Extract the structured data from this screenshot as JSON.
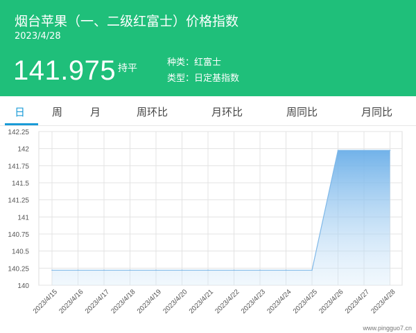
{
  "header": {
    "title": "烟台苹果（一、二级红富士）价格指数",
    "date": "2023/4/28",
    "price": "141.975",
    "change": "持平",
    "category_label": "种类：",
    "category_value": "红富士",
    "type_label": "类型：",
    "type_value": "日定基指数"
  },
  "colors": {
    "brand": "#1fbf7a",
    "active_tab": "#1a9bd7",
    "line": "#7fb8e8"
  },
  "tabs": [
    {
      "label": "日",
      "active": true
    },
    {
      "label": "周",
      "active": false
    },
    {
      "label": "月",
      "active": false
    },
    {
      "label": "周环比",
      "active": false
    },
    {
      "label": "月环比",
      "active": false
    },
    {
      "label": "周同比",
      "active": false
    },
    {
      "label": "月同比",
      "active": false
    }
  ],
  "watermark": "www.pingguo7.cn",
  "chart_data": {
    "type": "area",
    "x": [
      "2023/4/15",
      "2023/4/16",
      "2023/4/17",
      "2023/4/18",
      "2023/4/19",
      "2023/4/20",
      "2023/4/21",
      "2023/4/22",
      "2023/4/23",
      "2023/4/24",
      "2023/4/25",
      "2023/4/26",
      "2023/4/27",
      "2023/4/28"
    ],
    "values": [
      140.22,
      140.22,
      140.22,
      140.22,
      140.22,
      140.22,
      140.22,
      140.22,
      140.22,
      140.22,
      140.22,
      141.975,
      141.975,
      141.975
    ],
    "ylim": [
      140,
      142.25
    ],
    "yticks": [
      "140",
      "140.25",
      "140.5",
      "140.75",
      "141",
      "141.25",
      "141.5",
      "141.75",
      "142",
      "142.25"
    ],
    "grid": true
  }
}
